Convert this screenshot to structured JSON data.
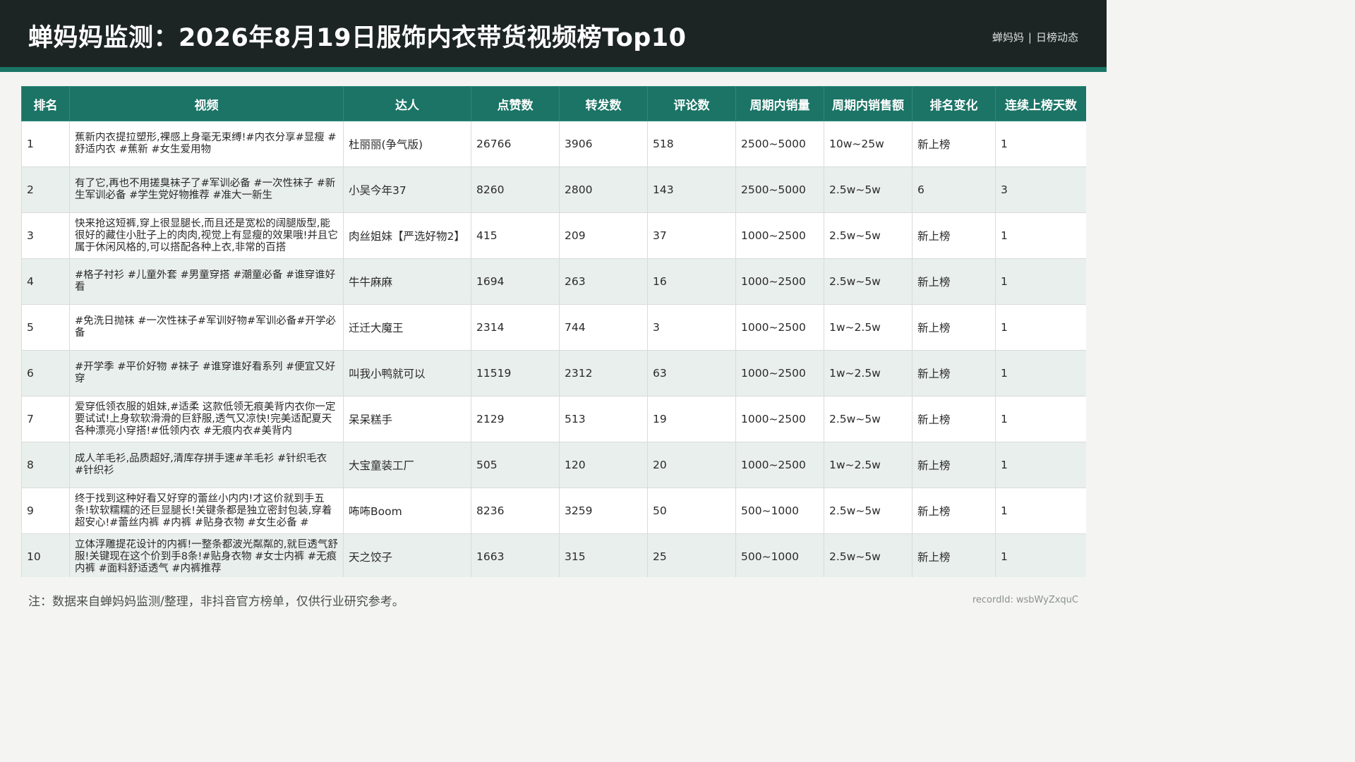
{
  "header": {
    "title": "蝉妈妈监测：2026年8月19日服饰内衣带货视频榜Top10",
    "brand_name": "蝉妈妈",
    "brand_separator": "|",
    "brand_section": "日榜动态"
  },
  "table": {
    "columns": [
      "排名",
      "视频",
      "达人",
      "点赞数",
      "转发数",
      "评论数",
      "周期内销量",
      "周期内销售额",
      "排名变化",
      "连续上榜天数"
    ],
    "rows": [
      {
        "rank": "1",
        "video": "蕉新内衣提拉塑形,裸感上身毫无束缚!#内衣分享#显瘦 #舒适内衣 #蕉新 #女生爱用物",
        "creator": "杜丽丽(争气版)",
        "likes": "26766",
        "shares": "3906",
        "comments": "518",
        "sales": "2500~5000",
        "revenue": "10w~25w",
        "change": "新上榜",
        "days": "1"
      },
      {
        "rank": "2",
        "video": "有了它,再也不用搓臭袜子了#军训必备 #一次性袜子 #新生军训必备 #学生党好物推荐 #准大一新生",
        "creator": "小吴今年37",
        "likes": "8260",
        "shares": "2800",
        "comments": "143",
        "sales": "2500~5000",
        "revenue": "2.5w~5w",
        "change": "6",
        "days": "3"
      },
      {
        "rank": "3",
        "video": "快来抢这短裤,穿上很显腿长,而且还是宽松的阔腿版型,能很好的藏住小肚子上的肉肉,视觉上有显瘦的效果哦!并且它属于休闲风格的,可以搭配各种上衣,非常的百搭",
        "creator": "肉丝姐妹【严选好物2】",
        "likes": "415",
        "shares": "209",
        "comments": "37",
        "sales": "1000~2500",
        "revenue": "2.5w~5w",
        "change": "新上榜",
        "days": "1"
      },
      {
        "rank": "4",
        "video": "#格子衬衫 #儿童外套 #男童穿搭 #潮童必备 #谁穿谁好看",
        "creator": "牛牛麻麻",
        "likes": "1694",
        "shares": "263",
        "comments": "16",
        "sales": "1000~2500",
        "revenue": "2.5w~5w",
        "change": "新上榜",
        "days": "1"
      },
      {
        "rank": "5",
        "video": "#免洗日抛袜 #一次性袜子#军训好物#军训必备#开学必备",
        "creator": "迁迁大魔王",
        "likes": "2314",
        "shares": "744",
        "comments": "3",
        "sales": "1000~2500",
        "revenue": "1w~2.5w",
        "change": "新上榜",
        "days": "1"
      },
      {
        "rank": "6",
        "video": "#开学季 #平价好物 #袜子 #谁穿谁好看系列 #便宜又好穿",
        "creator": "叫我小鸭就可以",
        "likes": "11519",
        "shares": "2312",
        "comments": "63",
        "sales": "1000~2500",
        "revenue": "1w~2.5w",
        "change": "新上榜",
        "days": "1"
      },
      {
        "rank": "7",
        "video": "爱穿低领衣服的姐妹,#适柔 这款低领无痕美背内衣你一定要试试!上身软软滑滑的巨舒服,透气又凉快!完美适配夏天各种漂亮小穿搭!#低领内衣 #无痕内衣#美背内",
        "creator": "呆呆糕手",
        "likes": "2129",
        "shares": "513",
        "comments": "19",
        "sales": "1000~2500",
        "revenue": "2.5w~5w",
        "change": "新上榜",
        "days": "1"
      },
      {
        "rank": "8",
        "video": "成人羊毛衫,品质超好,清库存拼手速#羊毛衫 #针织毛衣 #针织衫",
        "creator": "大宝童装工厂",
        "likes": "505",
        "shares": "120",
        "comments": "20",
        "sales": "1000~2500",
        "revenue": "1w~2.5w",
        "change": "新上榜",
        "days": "1"
      },
      {
        "rank": "9",
        "video": "终于找到这种好看又好穿的蕾丝小内内!才这价就到手五条!软软糯糯的还巨显腿长!关键条都是独立密封包装,穿着超安心!#蕾丝内裤 #内裤 #贴身衣物 #女生必备 #",
        "creator": "咘咘Boom",
        "likes": "8236",
        "shares": "3259",
        "comments": "50",
        "sales": "500~1000",
        "revenue": "2.5w~5w",
        "change": "新上榜",
        "days": "1"
      },
      {
        "rank": "10",
        "video": "立体浮雕提花设计的内裤!一整条都波光粼粼的,就巨透气舒服!关键现在这个价到手8条!#贴身衣物 #女士内裤 #无痕内裤 #面料舒适透气 #内裤推荐",
        "creator": "天之饺子",
        "likes": "1663",
        "shares": "315",
        "comments": "25",
        "sales": "500~1000",
        "revenue": "2.5w~5w",
        "change": "新上榜",
        "days": "1"
      }
    ]
  },
  "footer": {
    "note": "注：数据来自蝉妈妈监测/整理，非抖音官方榜单，仅供行业研究参考。",
    "record_label": "recordId:",
    "record_id": "wsbWyZxquC"
  }
}
